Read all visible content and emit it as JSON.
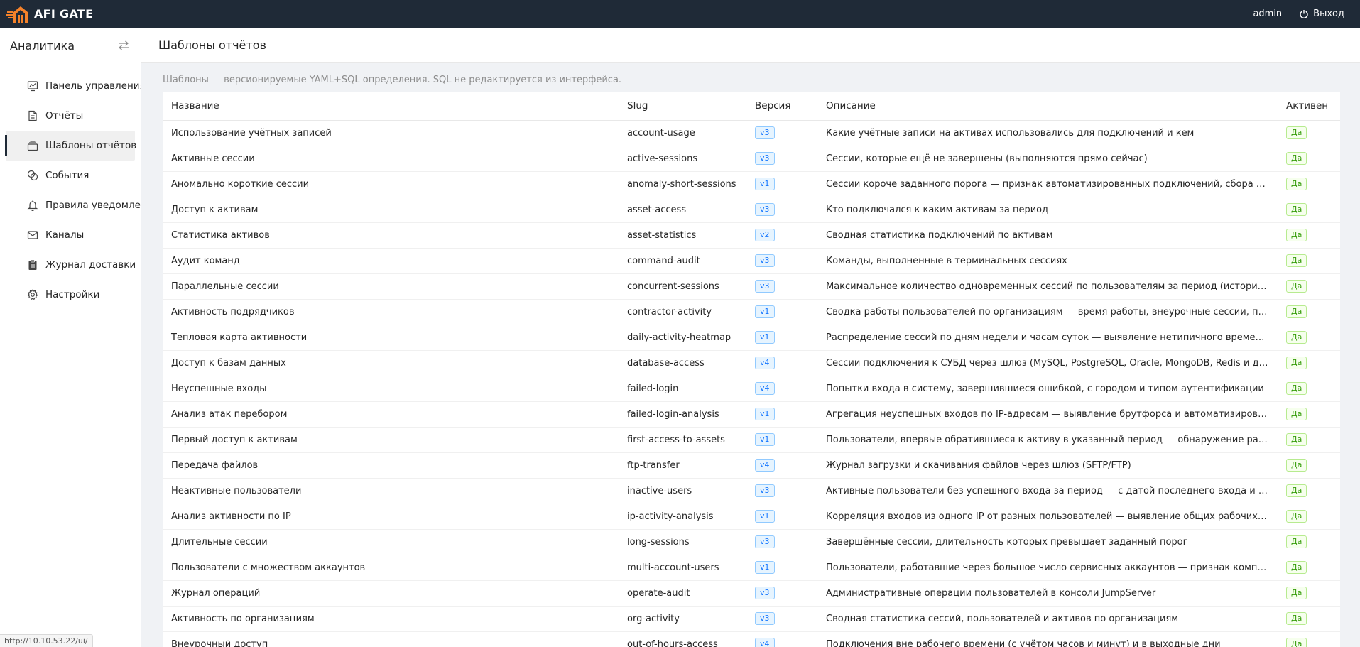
{
  "topbar": {
    "logo_text": "AFI GATE",
    "user": "admin",
    "logout_label": "Выход",
    "colors": {
      "background": "#1f2a37",
      "logo_accent": "#f5822a"
    }
  },
  "sidebar": {
    "title": "Аналитика",
    "toggle_icon": "swap-icon",
    "items": [
      {
        "label": "Панель управления",
        "icon": "dashboard-icon",
        "active": false
      },
      {
        "label": "Отчёты",
        "icon": "file-icon",
        "active": false
      },
      {
        "label": "Шаблоны отчётов",
        "icon": "template-icon",
        "active": true
      },
      {
        "label": "События",
        "icon": "event-icon",
        "active": false
      },
      {
        "label": "Правила уведомлений",
        "icon": "bell-icon",
        "active": false
      },
      {
        "label": "Каналы",
        "icon": "mail-icon",
        "active": false
      },
      {
        "label": "Журнал доставки",
        "icon": "clipboard-icon",
        "active": false
      },
      {
        "label": "Настройки",
        "icon": "gear-icon",
        "active": false
      }
    ]
  },
  "page": {
    "title": "Шаблоны отчётов",
    "hint": "Шаблоны — версионируемые YAML+SQL определения. SQL не редактируется из интерфейса."
  },
  "table": {
    "columns": [
      "Название",
      "Slug",
      "Версия",
      "Описание",
      "Активен"
    ],
    "rows": [
      {
        "name": "Использование учётных записей",
        "slug": "account-usage",
        "version": "v3",
        "description": "Какие учётные записи на активах использовались для подключений и кем",
        "active": "Да"
      },
      {
        "name": "Активные сессии",
        "slug": "active-sessions",
        "version": "v3",
        "description": "Сессии, которые ещё не завершены (выполняются прямо сейчас)",
        "active": "Да"
      },
      {
        "name": "Аномально короткие сессии",
        "slug": "anomaly-short-sessions",
        "version": "v1",
        "description": "Сессии короче заданного порога — признак автоматизированных подключений, сбора данны...",
        "active": "Да"
      },
      {
        "name": "Доступ к активам",
        "slug": "asset-access",
        "version": "v3",
        "description": "Кто подключался к каким активам за период",
        "active": "Да"
      },
      {
        "name": "Статистика активов",
        "slug": "asset-statistics",
        "version": "v2",
        "description": "Сводная статистика подключений по активам",
        "active": "Да"
      },
      {
        "name": "Аудит команд",
        "slug": "command-audit",
        "version": "v3",
        "description": "Команды, выполненные в терминальных сессиях",
        "active": "Да"
      },
      {
        "name": "Параллельные сессии",
        "slug": "concurrent-sessions",
        "version": "v3",
        "description": "Максимальное количество одновременных сессий по пользователям за период (исторически...",
        "active": "Да"
      },
      {
        "name": "Активность подрядчиков",
        "slug": "contractor-activity",
        "version": "v1",
        "description": "Сводка работы пользователей по организациям — время работы, внеурочные сессии, послед...",
        "active": "Да"
      },
      {
        "name": "Тепловая карта активности",
        "slug": "daily-activity-heatmap",
        "version": "v1",
        "description": "Распределение сессий по дням недели и часам суток — выявление нетипичного времени раб...",
        "active": "Да"
      },
      {
        "name": "Доступ к базам данных",
        "slug": "database-access",
        "version": "v4",
        "description": "Сессии подключения к СУБД через шлюз (MySQL, PostgreSQL, Oracle, MongoDB, Redis и др.)",
        "active": "Да"
      },
      {
        "name": "Неуспешные входы",
        "slug": "failed-login",
        "version": "v4",
        "description": "Попытки входа в систему, завершившиеся ошибкой, с городом и типом аутентификации",
        "active": "Да"
      },
      {
        "name": "Анализ атак перебором",
        "slug": "failed-login-analysis",
        "version": "v1",
        "description": "Агрегация неуспешных входов по IP-адресам — выявление брутфорса и автоматизированных ...",
        "active": "Да"
      },
      {
        "name": "Первый доступ к активам",
        "slug": "first-access-to-assets",
        "version": "v1",
        "description": "Пользователи, впервые обратившиеся к активу в указанный период — обнаружение расшире...",
        "active": "Да"
      },
      {
        "name": "Передача файлов",
        "slug": "ftp-transfer",
        "version": "v4",
        "description": "Журнал загрузки и скачивания файлов через шлюз (SFTP/FTP)",
        "active": "Да"
      },
      {
        "name": "Неактивные пользователи",
        "slug": "inactive-users",
        "version": "v3",
        "description": "Активные пользователи без успешного входа за период — с датой последнего входа и числом ...",
        "active": "Да"
      },
      {
        "name": "Анализ активности по IP",
        "slug": "ip-activity-analysis",
        "version": "v1",
        "description": "Корреляция входов из одного IP от разных пользователей — выявление общих рабочих станц...",
        "active": "Да"
      },
      {
        "name": "Длительные сессии",
        "slug": "long-sessions",
        "version": "v3",
        "description": "Завершённые сессии, длительность которых превышает заданный порог",
        "active": "Да"
      },
      {
        "name": "Пользователи с множеством аккаунтов",
        "slug": "multi-account-users",
        "version": "v1",
        "description": "Пользователи, работавшие через большое число сервисных аккаунтов — признак компромет...",
        "active": "Да"
      },
      {
        "name": "Журнал операций",
        "slug": "operate-audit",
        "version": "v3",
        "description": "Административные операции пользователей в консоли JumpServer",
        "active": "Да"
      },
      {
        "name": "Активность по организациям",
        "slug": "org-activity",
        "version": "v3",
        "description": "Сводная статистика сессий, пользователей и активов по организациям",
        "active": "Да"
      },
      {
        "name": "Внеурочный доступ",
        "slug": "out-of-hours-access",
        "version": "v4",
        "description": "Подключения вне рабочего времени (с учётом часов и минут) и в выходные дни",
        "active": "Да"
      }
    ]
  },
  "statusbar": {
    "url": "http://10.10.53.22/ui/"
  }
}
